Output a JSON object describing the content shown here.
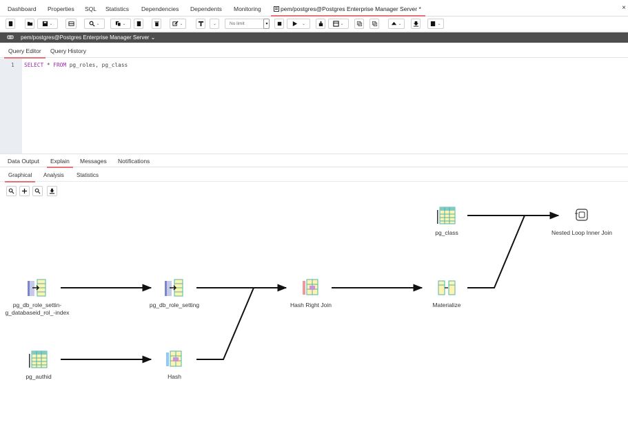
{
  "top_tabs": [
    {
      "label": "Dashboard"
    },
    {
      "label": "Properties"
    },
    {
      "label": "SQL"
    },
    {
      "label": "Statistics"
    },
    {
      "label": "Dependencies"
    },
    {
      "label": "Dependents"
    },
    {
      "label": "Monitoring"
    },
    {
      "label": "pem/postgres@Postgres Enterprise Manager Server *"
    }
  ],
  "close_glyph": "×",
  "toolbar": {
    "limit_placeholder": "No limit"
  },
  "connection": {
    "label": "pem/postgres@Postgres Enterprise Manager Server ⌄"
  },
  "query_tabs": [
    {
      "label": "Query Editor"
    },
    {
      "label": "Query History"
    }
  ],
  "editor": {
    "line_number": "1",
    "keyword_select": "SELECT",
    "star": " * ",
    "keyword_from": "FROM",
    "rest": " pg_roles, pg_class"
  },
  "output_tabs": [
    {
      "label": "Data Output"
    },
    {
      "label": "Explain"
    },
    {
      "label": "Messages"
    },
    {
      "label": "Notifications"
    }
  ],
  "explain_tabs": [
    {
      "label": "Graphical"
    },
    {
      "label": "Analysis"
    },
    {
      "label": "Statistics"
    }
  ],
  "plan_nodes": [
    {
      "label": "pg_db_role_settin-g_databaseid_rol_-index",
      "icon": "index-scan-icon"
    },
    {
      "label": "pg_db_role_setting",
      "icon": "index-scan-icon"
    },
    {
      "label": "Hash Right Join",
      "icon": "hash-join-icon"
    },
    {
      "label": "Materialize",
      "icon": "materialize-icon"
    },
    {
      "label": "pg_class",
      "icon": "seq-scan-icon"
    },
    {
      "label": "Nested Loop Inner Join",
      "icon": "nested-loop-icon"
    },
    {
      "label": "pg_authid",
      "icon": "seq-scan-icon"
    },
    {
      "label": "Hash",
      "icon": "hash-icon"
    }
  ],
  "colors": {
    "accent": "#e57373",
    "connection_bar": "#4d4d4d",
    "gutter": "#eaedf2",
    "keyword": "#9c27b0"
  }
}
